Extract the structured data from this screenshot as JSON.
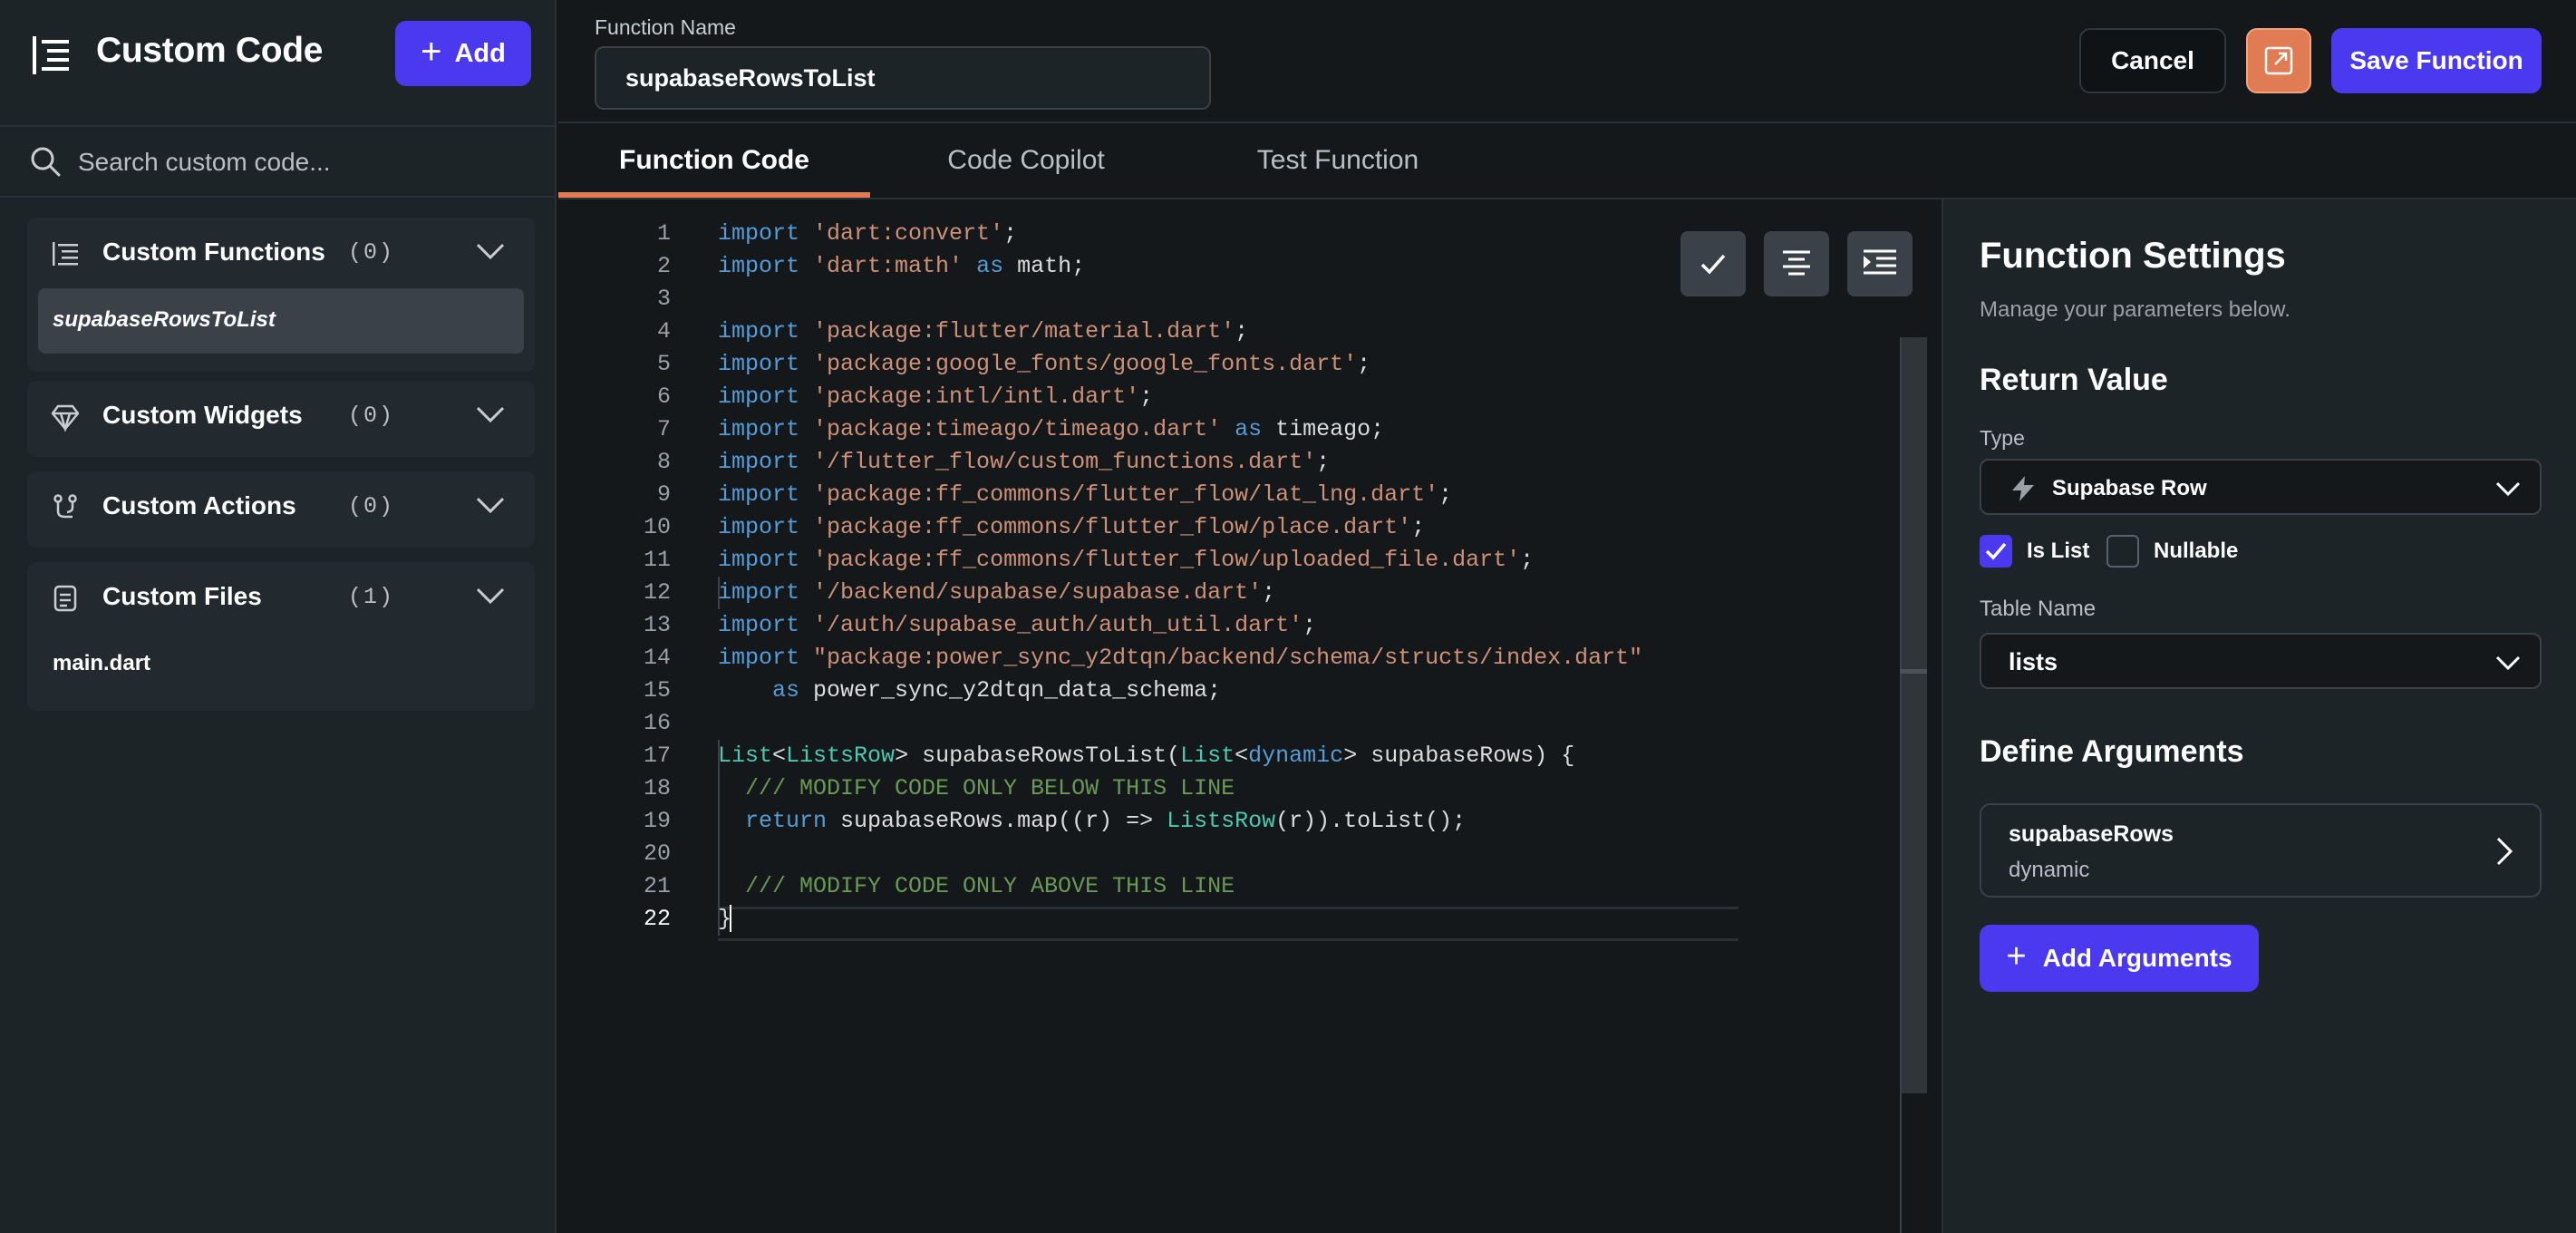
{
  "sidebar": {
    "title": "Custom Code",
    "add_label": "Add",
    "search_placeholder": "Search custom code...",
    "sections": [
      {
        "title": "Custom Functions",
        "count": "(0)",
        "icon": "functions-icon",
        "items": [
          "supabaseRowsToList"
        ]
      },
      {
        "title": "Custom Widgets",
        "count": "(0)",
        "icon": "diamond-icon",
        "items": []
      },
      {
        "title": "Custom Actions",
        "count": "(0)",
        "icon": "branch-icon",
        "items": []
      },
      {
        "title": "Custom Files",
        "count": "(1)",
        "icon": "file-icon",
        "items": [
          "main.dart"
        ]
      }
    ]
  },
  "header": {
    "function_name_label": "Function Name",
    "function_name": "supabaseRowsToList",
    "cancel_label": "Cancel",
    "open_icon": "external-link-icon",
    "save_label": "Save Function"
  },
  "tabs": [
    "Function Code",
    "Code Copilot",
    "Test Function"
  ],
  "editor": {
    "lines": [
      "import 'dart:convert';",
      "import 'dart:math' as math;",
      "",
      "import 'package:flutter/material.dart';",
      "import 'package:google_fonts/google_fonts.dart';",
      "import 'package:intl/intl.dart';",
      "import 'package:timeago/timeago.dart' as timeago;",
      "import '/flutter_flow/custom_functions.dart';",
      "import 'package:ff_commons/flutter_flow/lat_lng.dart';",
      "import 'package:ff_commons/flutter_flow/place.dart';",
      "import 'package:ff_commons/flutter_flow/uploaded_file.dart';",
      "import '/backend/supabase/supabase.dart';",
      "import '/auth/supabase_auth/auth_util.dart';",
      "import \"package:power_sync_y2dtqn/backend/schema/structs/index.dart\"",
      "    as power_sync_y2dtqn_data_schema;",
      "",
      "List<ListsRow> supabaseRowsToList(List<dynamic> supabaseRows) {",
      "  /// MODIFY CODE ONLY BELOW THIS LINE",
      "  return supabaseRows.map((r) => ListsRow(r)).toList();",
      "",
      "  /// MODIFY CODE ONLY ABOVE THIS LINE",
      "}"
    ],
    "current_line": 22,
    "toolbar_icons": [
      "check-icon",
      "align-center-icon",
      "indent-icon"
    ]
  },
  "settings": {
    "title": "Function Settings",
    "subtitle": "Manage your parameters below.",
    "return_value_title": "Return Value",
    "type_label": "Type",
    "type_value": "Supabase Row",
    "is_list_label": "Is List",
    "is_list_checked": true,
    "nullable_label": "Nullable",
    "nullable_checked": false,
    "table_name_label": "Table Name",
    "table_name_value": "lists",
    "define_args_title": "Define Arguments",
    "argument": {
      "name": "supabaseRows",
      "type": "dynamic"
    },
    "add_args_label": "Add Arguments"
  },
  "colors": {
    "accent": "#4b39ef",
    "tab_underline": "#e07b53",
    "background": "#14181b",
    "panel": "#1d2428"
  }
}
